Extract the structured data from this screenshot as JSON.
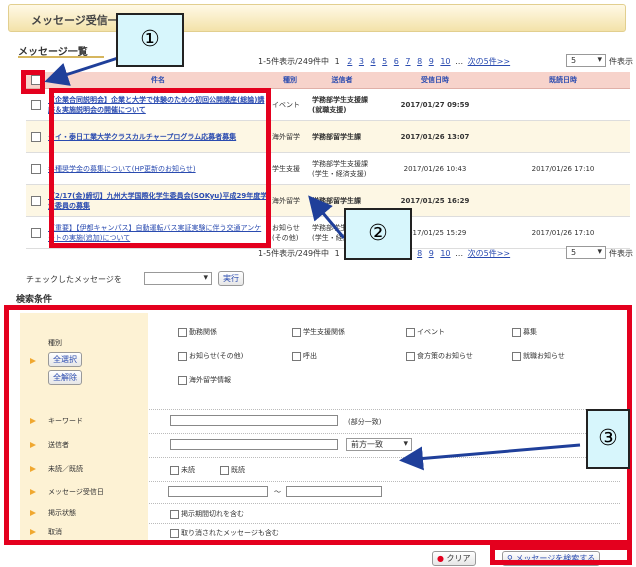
{
  "page": {
    "title": "メッセージ受信一覧",
    "section_list": "メッセージ一覧",
    "section_search": "検索条件"
  },
  "pager": {
    "summary": "1-5件表示/249件中",
    "pages": [
      "1",
      "2",
      "3",
      "4",
      "5",
      "6",
      "7",
      "8",
      "9",
      "10"
    ],
    "current_page": "1",
    "ellipsis": "…",
    "next": "次の5件>>",
    "per_page": "5",
    "per_page_unit": "件表示",
    "summary_bottom": "1-5件表示/249件中"
  },
  "table": {
    "headers": [
      "件名",
      "種別",
      "送信者",
      "受信日時",
      "既読日時"
    ],
    "rows": [
      {
        "subject": "【企業合同説明会】企業と大学で体験のための初回公開講座(総論)講座＆実施説明会の開催について",
        "type": "イベント",
        "sender": "学務部学生支援課(就職支援)",
        "received": "2017/01/27 09:59",
        "read": ""
      },
      {
        "subject": "タイ・泰日工業大学クラスカルチャープログラム応募者募集",
        "type": "海外留学",
        "sender": "学務部留学生課",
        "received": "2017/01/26 13:07",
        "read": ""
      },
      {
        "subject": "各種奨学金の募集について(HP更新のお知らせ)",
        "type": "学生支援",
        "sender": "学務部学生支援課(学生・経済支援)",
        "received": "2017/01/26 10:43",
        "read": "2017/01/26 17:10"
      },
      {
        "subject": "【2/17(金)締切】九州大学国際化学生委員会(SOKyu)平成29年度学生委員の募集",
        "type": "海外留学",
        "sender": "学務部留学生課",
        "received": "2017/01/25 16:29",
        "read": ""
      },
      {
        "subject": "【重要】【伊都キャンパス】自動運転バス実証実験に伴う交通アンケートの実施(追加)について",
        "type": "お知らせ(その他)",
        "sender": "学務部学生支援課(学生・経済支援)",
        "received": "2017/01/25 15:29",
        "read": "2017/01/26 17:10"
      }
    ]
  },
  "bulk": {
    "label": "チェックしたメッセージを",
    "execute": "実行"
  },
  "search": {
    "type_label": "種別",
    "select_all": "全選択",
    "clear_all": "全解除",
    "type_options": [
      "勤務関係",
      "学生支援関係",
      "イベント",
      "募集",
      "お知らせ(その他)",
      "呼出",
      "食方策のお知らせ",
      "就職お知らせ",
      "海外留学情報"
    ],
    "keyword_label": "キーワード",
    "keyword_note": "(部分一致)",
    "sender_label": "送信者",
    "sender_match": "前方一致",
    "unread_label": "未読／既読",
    "unread_opt": "未読",
    "read_opt": "既読",
    "date_label": "メッセージ受信日",
    "date_sep": "〜",
    "status_label": "掲示状態",
    "status_opt": "掲示期間切れを含む",
    "cancel_label": "取消",
    "cancel_opt": "取り消されたメッセージも含む",
    "clear_button": "クリア",
    "search_button": "メッセージを検索する"
  },
  "callouts": {
    "one": "①",
    "two": "②",
    "three": "③"
  },
  "colors": {
    "annotation_red": "#e4001e",
    "callout_bg": "#d7f6fc",
    "link_blue": "#2a4bb0",
    "header_pink": "#f7d3cb"
  }
}
